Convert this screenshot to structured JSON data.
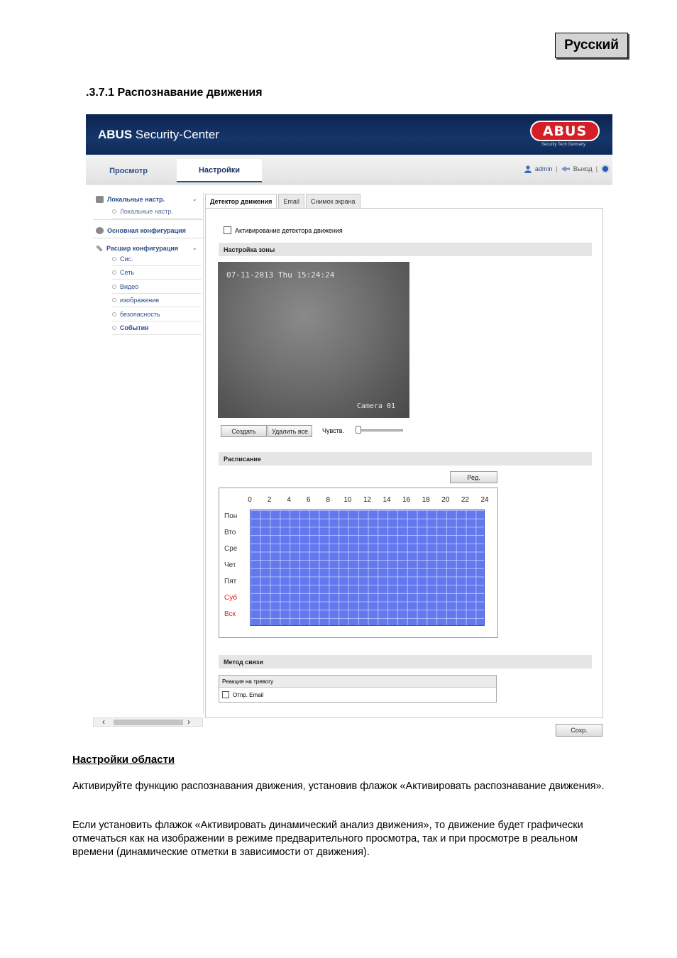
{
  "language_box": "Русский",
  "section_heading": ".3.7.1 Распознавание движения",
  "app": {
    "title_bold": "ABUS",
    "title_rest": " Security-Center",
    "logo_text": "ABUS",
    "logo_tagline": "Security Tech Germany",
    "nav_tabs": [
      "Просмотр",
      "Настройки"
    ],
    "active_nav_tab": "Настройки",
    "user": "admin",
    "logout": "Выход",
    "sidebar": {
      "groups": [
        {
          "label": "Локальные настр.",
          "icon": "monitor-icon",
          "expanded": true,
          "items": [
            "Локальные настр."
          ]
        },
        {
          "label": "Основная конфигурация",
          "icon": "gear-icon",
          "expanded": false,
          "items": []
        },
        {
          "label": "Расшир конфигурация",
          "icon": "wrench-icon",
          "expanded": true,
          "items": [
            "Сис.",
            "Сеть",
            "Видео",
            "изображение",
            "безопасность",
            "События"
          ]
        }
      ],
      "active_item": "События"
    },
    "content_tabs": [
      "Детектор движения",
      "Email",
      "Снимок экрана"
    ],
    "active_content_tab": "Детектор движения",
    "enable_label": "Активирование детектора движения",
    "enable_checked": false,
    "zone_section": "Настройка зоны",
    "video": {
      "timestamp": "07-11-2013 Thu 15:24:24",
      "camera_label": "Camera 01"
    },
    "buttons": {
      "create": "Создать",
      "delete_all": "Удалить все",
      "edit": "Ред.",
      "save": "Сохр."
    },
    "sensitivity_label": "Чувств.",
    "sensitivity_value": 0,
    "schedule_section": "Расписание",
    "schedule": {
      "hours": [
        "0",
        "2",
        "4",
        "6",
        "8",
        "10",
        "12",
        "14",
        "16",
        "18",
        "20",
        "22",
        "24"
      ],
      "days": [
        "Пон",
        "Вто",
        "Сре",
        "Чет",
        "Пят",
        "Суб",
        "Вск"
      ],
      "weekend_days": [
        "Суб",
        "Вск"
      ],
      "grid_color": "#6478ee"
    },
    "link_section": "Метод связи",
    "alarm_header": "Реакция на тревогу",
    "send_email_label": "Отпр. Email",
    "send_email_checked": false
  },
  "doc": {
    "subheading": "Настройки области",
    "para1": "Активируйте функцию распознавания движения, установив флажок «Активировать распознавание движения».",
    "para2": "Если установить флажок «Активировать динамический анализ движения», то движение будет графически отмечаться как на изображении в режиме предварительного просмотра, так и при просмотре в реальном времени (динамические отметки в зависимости от движения)."
  }
}
